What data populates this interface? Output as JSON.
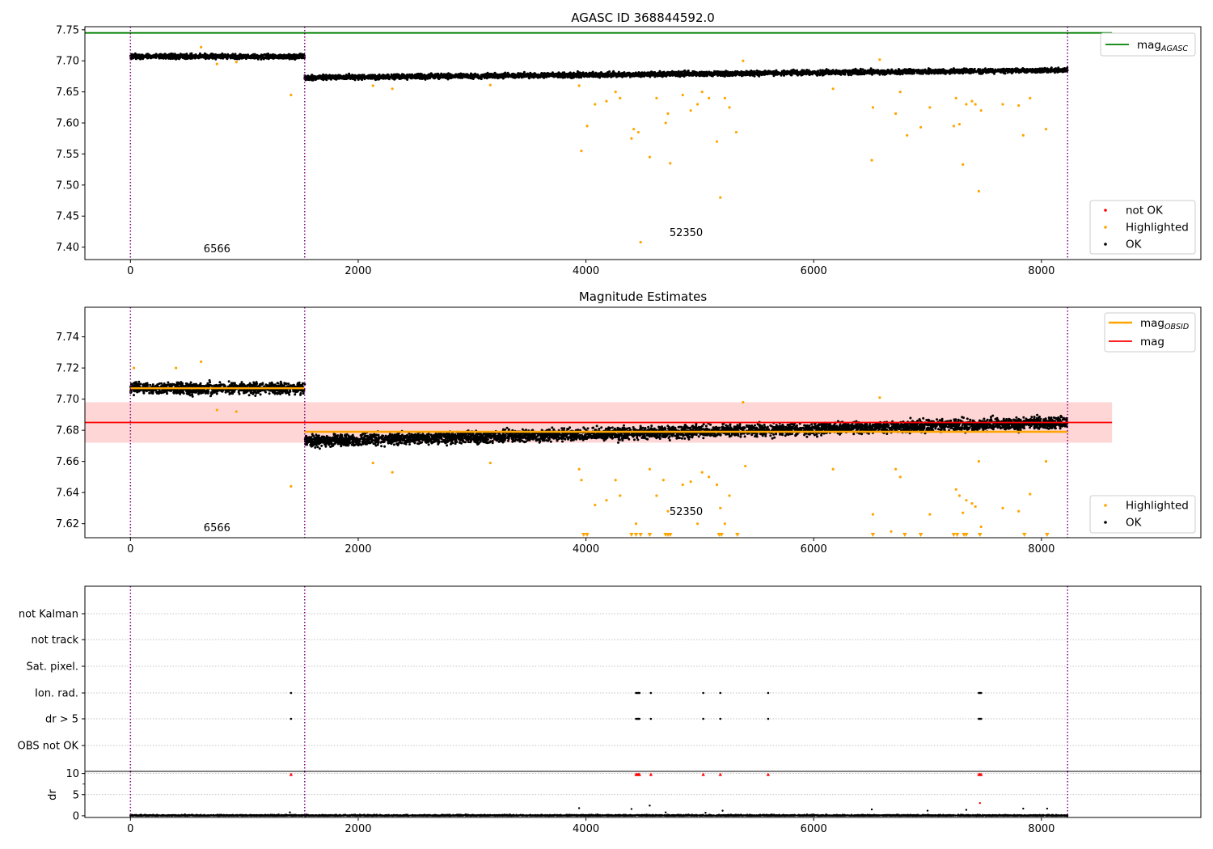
{
  "colors": {
    "ok": "#000000",
    "highlighted": "#ffa500",
    "not_ok": "#ff0000",
    "agasc_line": "#008000",
    "mag_line": "#ff0000",
    "obsid_line": "#ffa500",
    "obs_boundary": "#800080",
    "mag_band": "#ffd6d6"
  },
  "observations": {
    "boundaries": [
      0,
      1530,
      8230
    ],
    "labels": [
      {
        "text": "6566",
        "x": 760
      },
      {
        "text": "52350",
        "x": 4880
      }
    ]
  },
  "chart_data": [
    {
      "name": "agasc-panel",
      "type": "scatter",
      "title": "AGASC ID 368844592.0",
      "xlim": [
        -400,
        9400
      ],
      "ylim": [
        7.38,
        7.755
      ],
      "xticks": [
        "0",
        "2000",
        "4000",
        "6000",
        "8000"
      ],
      "xtick_values": [
        0,
        2000,
        4000,
        6000,
        8000
      ],
      "yticks": [
        "7.40",
        "7.45",
        "7.50",
        "7.55",
        "7.60",
        "7.65",
        "7.70",
        "7.75"
      ],
      "ytick_values": [
        7.4,
        7.45,
        7.5,
        7.55,
        7.6,
        7.65,
        7.7,
        7.75
      ],
      "mag_agasc": 7.745,
      "segments": [
        {
          "x": [
            0,
            1530
          ],
          "mag": 7.707,
          "spread": 0.004
        },
        {
          "x": [
            1530,
            8230
          ],
          "mag_start": 7.673,
          "mag_end": 7.685,
          "spread": 0.004
        }
      ],
      "highlighted_points": [
        [
          620,
          7.722
        ],
        [
          760,
          7.695
        ],
        [
          930,
          7.698
        ],
        [
          1410,
          7.645
        ],
        [
          2130,
          7.66
        ],
        [
          2300,
          7.655
        ],
        [
          3160,
          7.661
        ],
        [
          3940,
          7.66
        ],
        [
          3960,
          7.555
        ],
        [
          4010,
          7.595
        ],
        [
          4080,
          7.63
        ],
        [
          4180,
          7.635
        ],
        [
          4260,
          7.65
        ],
        [
          4300,
          7.64
        ],
        [
          4400,
          7.575
        ],
        [
          4420,
          7.59
        ],
        [
          4460,
          7.585
        ],
        [
          4480,
          7.408
        ],
        [
          4560,
          7.545
        ],
        [
          4620,
          7.64
        ],
        [
          4700,
          7.6
        ],
        [
          4720,
          7.615
        ],
        [
          4740,
          7.535
        ],
        [
          4850,
          7.645
        ],
        [
          4920,
          7.62
        ],
        [
          4980,
          7.63
        ],
        [
          5020,
          7.65
        ],
        [
          5080,
          7.64
        ],
        [
          5150,
          7.57
        ],
        [
          5180,
          7.48
        ],
        [
          5220,
          7.64
        ],
        [
          5260,
          7.625
        ],
        [
          5320,
          7.585
        ],
        [
          5380,
          7.7
        ],
        [
          6170,
          7.655
        ],
        [
          6510,
          7.54
        ],
        [
          6520,
          7.625
        ],
        [
          6580,
          7.702
        ],
        [
          6720,
          7.615
        ],
        [
          6760,
          7.65
        ],
        [
          6820,
          7.58
        ],
        [
          6940,
          7.593
        ],
        [
          7020,
          7.625
        ],
        [
          7230,
          7.595
        ],
        [
          7250,
          7.64
        ],
        [
          7280,
          7.598
        ],
        [
          7310,
          7.533
        ],
        [
          7340,
          7.63
        ],
        [
          7390,
          7.635
        ],
        [
          7420,
          7.63
        ],
        [
          7450,
          7.49
        ],
        [
          7470,
          7.62
        ],
        [
          7660,
          7.63
        ],
        [
          7800,
          7.628
        ],
        [
          7840,
          7.58
        ],
        [
          7900,
          7.64
        ],
        [
          8040,
          7.59
        ]
      ],
      "legend": {
        "upper": [
          {
            "label": "mag",
            "sub": "AGASC"
          }
        ],
        "lower": [
          {
            "label": "not OK"
          },
          {
            "label": "Highlighted"
          },
          {
            "label": "OK"
          }
        ]
      }
    },
    {
      "name": "magnitude-panel",
      "type": "scatter",
      "title": "Magnitude Estimates",
      "xlim": [
        -400,
        9400
      ],
      "ylim": [
        7.611,
        7.759
      ],
      "xticks": [
        "0",
        "2000",
        "4000",
        "6000",
        "8000"
      ],
      "xtick_values": [
        0,
        2000,
        4000,
        6000,
        8000
      ],
      "yticks": [
        "7.62",
        "7.64",
        "7.66",
        "7.68",
        "7.70",
        "7.72",
        "7.74"
      ],
      "ytick_values": [
        7.62,
        7.64,
        7.66,
        7.68,
        7.7,
        7.72,
        7.74
      ],
      "mag": 7.685,
      "mag_band": [
        7.672,
        7.698
      ],
      "mag_obsid": [
        {
          "x": [
            0,
            1530
          ],
          "value": 7.707
        },
        {
          "x": [
            1530,
            8230
          ],
          "value": 7.679
        }
      ],
      "segments": [
        {
          "x": [
            0,
            1530
          ],
          "mag": 7.707,
          "spread": 0.004
        },
        {
          "x": [
            1530,
            8230
          ],
          "mag_start": 7.673,
          "mag_end": 7.685,
          "spread": 0.004
        }
      ],
      "highlighted_points": [
        [
          30,
          7.72
        ],
        [
          400,
          7.72
        ],
        [
          620,
          7.724
        ],
        [
          760,
          7.693
        ],
        [
          930,
          7.692
        ],
        [
          1410,
          7.644
        ],
        [
          2130,
          7.659
        ],
        [
          2300,
          7.653
        ],
        [
          3160,
          7.659
        ],
        [
          3940,
          7.655
        ],
        [
          3960,
          7.648
        ],
        [
          4080,
          7.632
        ],
        [
          4180,
          7.635
        ],
        [
          4260,
          7.648
        ],
        [
          4300,
          7.638
        ],
        [
          4440,
          7.62
        ],
        [
          4560,
          7.655
        ],
        [
          4620,
          7.638
        ],
        [
          4680,
          7.648
        ],
        [
          4720,
          7.628
        ],
        [
          4850,
          7.645
        ],
        [
          4920,
          7.647
        ],
        [
          4980,
          7.62
        ],
        [
          5020,
          7.653
        ],
        [
          5080,
          7.65
        ],
        [
          5150,
          7.645
        ],
        [
          5180,
          7.63
        ],
        [
          5220,
          7.62
        ],
        [
          5260,
          7.638
        ],
        [
          5380,
          7.698
        ],
        [
          5400,
          7.657
        ],
        [
          6170,
          7.655
        ],
        [
          6520,
          7.626
        ],
        [
          6580,
          7.701
        ],
        [
          6680,
          7.615
        ],
        [
          6720,
          7.655
        ],
        [
          6760,
          7.65
        ],
        [
          7020,
          7.626
        ],
        [
          7250,
          7.642
        ],
        [
          7280,
          7.638
        ],
        [
          7310,
          7.627
        ],
        [
          7340,
          7.635
        ],
        [
          7390,
          7.633
        ],
        [
          7420,
          7.631
        ],
        [
          7450,
          7.66
        ],
        [
          7470,
          7.618
        ],
        [
          7660,
          7.63
        ],
        [
          7800,
          7.628
        ],
        [
          7900,
          7.639
        ],
        [
          8040,
          7.66
        ]
      ],
      "clipped_x": [
        3980,
        4010,
        4400,
        4440,
        4480,
        4560,
        4700,
        4720,
        4740,
        5170,
        5190,
        5330,
        6520,
        6800,
        6940,
        7230,
        7260,
        7320,
        7340,
        7460,
        7850,
        8050
      ],
      "legend": {
        "upper": [
          {
            "label": "mag",
            "sub": "OBSID"
          },
          {
            "label": "mag"
          }
        ],
        "lower": [
          {
            "label": "Highlighted"
          },
          {
            "label": "OK"
          }
        ]
      }
    },
    {
      "name": "flags-panel",
      "type": "scatter",
      "title": "",
      "xlim": [
        -400,
        9400
      ],
      "xticks": [
        "0",
        "2000",
        "4000",
        "6000",
        "8000"
      ],
      "xtick_values": [
        0,
        2000,
        4000,
        6000,
        8000
      ],
      "flag_rows": [
        "not Kalman",
        "not track",
        "Sat. pixel.",
        "Ion. rad.",
        "dr > 5",
        "OBS not OK"
      ],
      "flag_points": {
        "Ion. rad.": [
          1410,
          4440,
          4450,
          4460,
          4470,
          4570,
          5030,
          5180,
          5600,
          7450,
          7460,
          7470
        ],
        "dr > 5": [
          1410,
          4440,
          4450,
          4460,
          4470,
          4570,
          5030,
          5180,
          5600,
          7450,
          7460,
          7470
        ]
      }
    },
    {
      "name": "dr-panel",
      "type": "scatter",
      "title": "",
      "ylabel": "dr",
      "xlim": [
        -400,
        9400
      ],
      "ylim": [
        -0.4,
        10.5
      ],
      "xticks": [
        "0",
        "2000",
        "4000",
        "6000",
        "8000"
      ],
      "xtick_values": [
        0,
        2000,
        4000,
        6000,
        8000
      ],
      "yticks": [
        "0",
        "5",
        "10"
      ],
      "ytick_values": [
        0,
        5,
        10
      ],
      "clipped_x": [
        1410,
        4440,
        4450,
        4460,
        4470,
        4570,
        5030,
        5180,
        5600,
        7450,
        7460,
        7470
      ],
      "outliers": [
        [
          1400,
          0.8
        ],
        [
          3940,
          1.8
        ],
        [
          4400,
          1.6
        ],
        [
          4560,
          2.4
        ],
        [
          4700,
          0.8
        ],
        [
          5050,
          0.7
        ],
        [
          5200,
          1.2
        ],
        [
          6510,
          1.5
        ],
        [
          7000,
          1.2
        ],
        [
          7340,
          1.4
        ],
        [
          7460,
          3.0
        ],
        [
          7840,
          1.7
        ],
        [
          8050,
          1.7
        ]
      ]
    }
  ]
}
